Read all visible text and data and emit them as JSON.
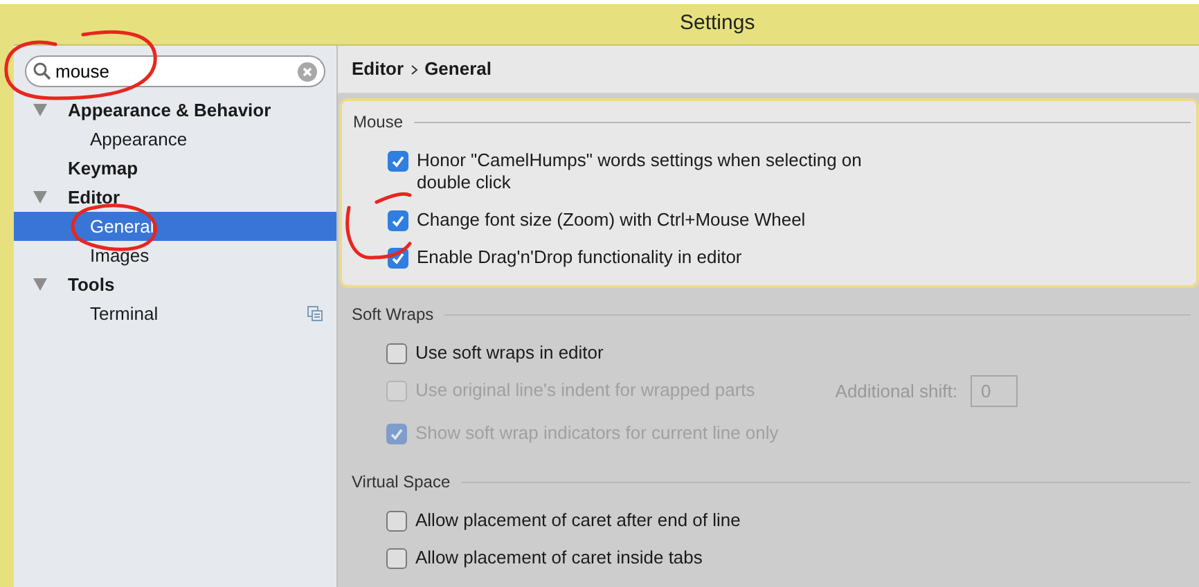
{
  "window": {
    "title": "Settings"
  },
  "search": {
    "value": "mouse"
  },
  "tree": [
    {
      "label": "Appearance & Behavior",
      "expanded": true,
      "selected": false,
      "children": [
        {
          "label": "Appearance",
          "selected": false
        }
      ]
    },
    {
      "label": "Keymap",
      "selected": false
    },
    {
      "label": "Editor",
      "expanded": true,
      "selected": false,
      "children": [
        {
          "label": "General",
          "selected": true
        },
        {
          "label": "Images",
          "selected": false
        }
      ]
    },
    {
      "label": "Tools",
      "expanded": true,
      "selected": false,
      "children": [
        {
          "label": "Terminal",
          "selected": false,
          "project_level": true
        }
      ]
    }
  ],
  "breadcrumb": [
    "Editor",
    "General"
  ],
  "sections": [
    {
      "title": "Mouse",
      "highlighted": true,
      "options": [
        {
          "label": "Honor \"CamelHumps\" words settings when selecting on double click",
          "checked": true,
          "disabled": false
        },
        {
          "label": "Change font size (Zoom) with Ctrl+Mouse Wheel",
          "checked": true,
          "disabled": false
        },
        {
          "label": "Enable Drag'n'Drop functionality in editor",
          "checked": true,
          "disabled": false
        }
      ]
    },
    {
      "title": "Soft Wraps",
      "highlighted": false,
      "options": [
        {
          "label": "Use soft wraps in editor",
          "checked": false,
          "disabled": false
        },
        {
          "label": "Use original line's indent for wrapped parts",
          "checked": false,
          "disabled": true,
          "extra": {
            "label": "Additional shift:",
            "value": "0"
          }
        },
        {
          "label": "Show soft wrap indicators for current line only",
          "checked": true,
          "disabled": true
        }
      ]
    },
    {
      "title": "Virtual Space",
      "highlighted": false,
      "options": [
        {
          "label": "Allow placement of caret after end of line",
          "checked": false,
          "disabled": false
        },
        {
          "label": "Allow placement of caret inside tabs",
          "checked": false,
          "disabled": false
        }
      ]
    }
  ]
}
